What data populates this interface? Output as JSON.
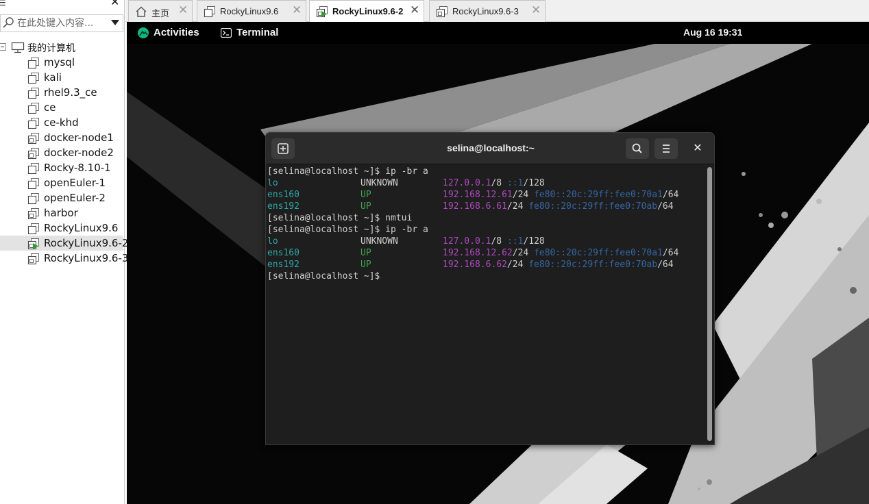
{
  "library": {
    "search_placeholder": "在此处键入内容...",
    "root_label": "我的计算机",
    "vms": [
      {
        "name": "mysql",
        "icon": "vm-icon"
      },
      {
        "name": "kali",
        "icon": "vm-icon"
      },
      {
        "name": "rhel9.3_ce",
        "icon": "vm-icon"
      },
      {
        "name": "ce",
        "icon": "vm-icon"
      },
      {
        "name": "ce-khd",
        "icon": "vm-icon"
      },
      {
        "name": "docker-node1",
        "icon": "vm-linked-icon"
      },
      {
        "name": "docker-node2",
        "icon": "vm-linked-icon"
      },
      {
        "name": "Rocky-8.10-1",
        "icon": "vm-icon"
      },
      {
        "name": "openEuler-1",
        "icon": "vm-icon"
      },
      {
        "name": "openEuler-2",
        "icon": "vm-icon"
      },
      {
        "name": "harbor",
        "icon": "vm-linked-icon"
      },
      {
        "name": "RockyLinux9.6",
        "icon": "vm-icon"
      },
      {
        "name": "RockyLinux9.6-2",
        "icon": "vm-running-icon",
        "selected": true
      },
      {
        "name": "RockyLinux9.6-3",
        "icon": "vm-linked-icon"
      }
    ]
  },
  "tabs": [
    {
      "label": "主页",
      "icon": "home-icon",
      "active": false
    },
    {
      "label": "RockyLinux9.6",
      "icon": "vm-icon",
      "active": false
    },
    {
      "label": "RockyLinux9.6-2",
      "icon": "vm-running-icon",
      "active": true
    },
    {
      "label": "RockyLinux9.6-3",
      "icon": "vm-linked-icon",
      "active": false
    }
  ],
  "gnome": {
    "activities_label": "Activities",
    "app_menu_label": "Terminal",
    "clock": "Aug 16  19:31"
  },
  "terminal": {
    "title": "selina@localhost:~",
    "lines": [
      {
        "type": "prompt",
        "text": "[selina@localhost ~]$ ip -br a"
      },
      {
        "type": "iface",
        "iface": "lo",
        "state": "UNKNOWN",
        "ipv4": "127.0.0.1",
        "ipv4_mask": "/8",
        "ipv6": "::1",
        "ipv6_mask": "/128"
      },
      {
        "type": "iface",
        "iface": "ens160",
        "state": "UP",
        "ipv4": "192.168.12.61",
        "ipv4_mask": "/24",
        "ipv6": "fe80::20c:29ff:fee0:70a1",
        "ipv6_mask": "/64"
      },
      {
        "type": "iface",
        "iface": "ens192",
        "state": "UP",
        "ipv4": "192.168.6.61",
        "ipv4_mask": "/24",
        "ipv6": "fe80::20c:29ff:fee0:70ab",
        "ipv6_mask": "/64"
      },
      {
        "type": "prompt",
        "text": "[selina@localhost ~]$ nmtui"
      },
      {
        "type": "prompt",
        "text": "[selina@localhost ~]$ ip -br a"
      },
      {
        "type": "iface",
        "iface": "lo",
        "state": "UNKNOWN",
        "ipv4": "127.0.0.1",
        "ipv4_mask": "/8",
        "ipv6": "::1",
        "ipv6_mask": "/128"
      },
      {
        "type": "iface",
        "iface": "ens160",
        "state": "UP",
        "ipv4": "192.168.12.62",
        "ipv4_mask": "/24",
        "ipv6": "fe80::20c:29ff:fee0:70a1",
        "ipv6_mask": "/64"
      },
      {
        "type": "iface",
        "iface": "ens192",
        "state": "UP",
        "ipv4": "192.168.6.62",
        "ipv4_mask": "/24",
        "ipv6": "fe80::20c:29ff:fee0:70ab",
        "ipv6_mask": "/64"
      },
      {
        "type": "prompt",
        "text": "[selina@localhost ~]$ "
      }
    ]
  },
  "colors": {
    "iface": "#2fa6a6",
    "state_up": "#3fa34d",
    "ipv4": "#b148c2",
    "ipv6": "#3465a4",
    "rocky_green": "#10b981"
  }
}
